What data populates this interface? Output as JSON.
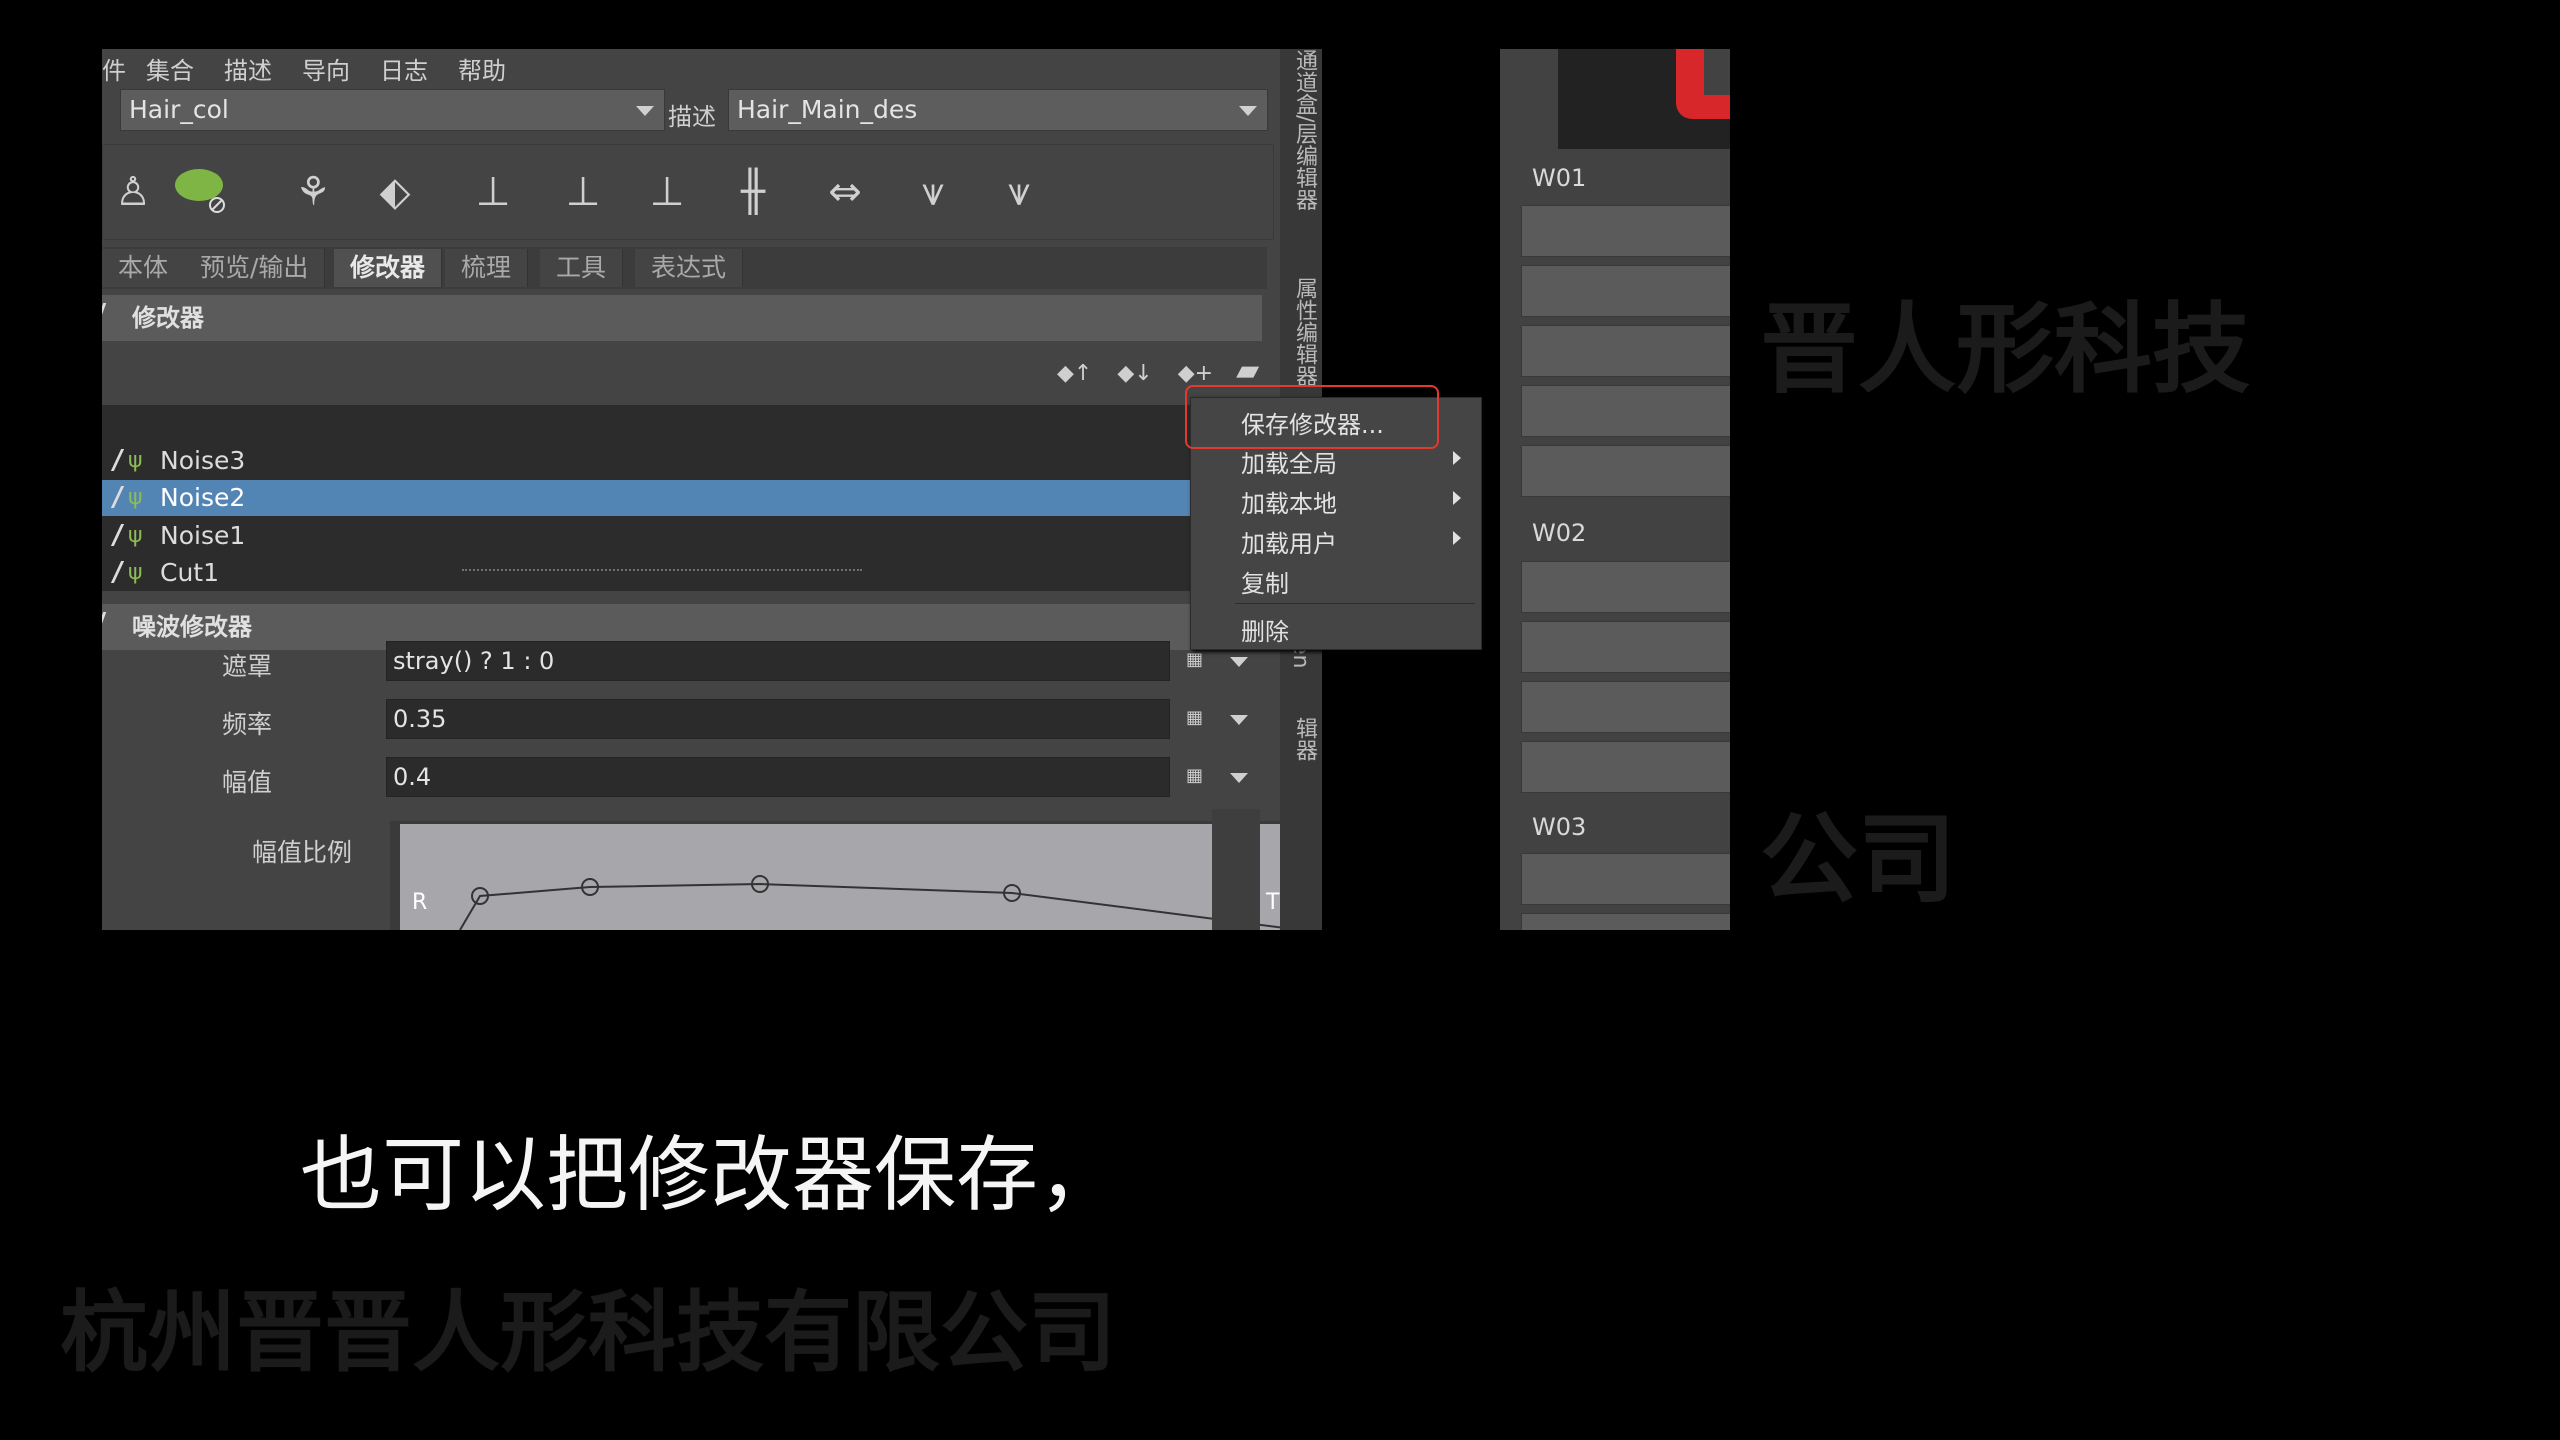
{
  "menubar": {
    "items": [
      "件",
      "集合",
      "描述",
      "导向",
      "日志",
      "帮助"
    ]
  },
  "collection": {
    "value": "Hair_col"
  },
  "description": {
    "label": "描述",
    "value": "Hair_Main_des"
  },
  "tabs": [
    {
      "label": "本体"
    },
    {
      "label": "预览/输出"
    },
    {
      "label": "修改器"
    },
    {
      "label": "梳理"
    },
    {
      "label": "工具"
    },
    {
      "label": "表达式"
    }
  ],
  "modifiers_section": {
    "title": "修改器"
  },
  "modifier_list": [
    "Noise3",
    "Noise2",
    "Noise1",
    "Cut1"
  ],
  "noise_section": {
    "title": "噪波修改器"
  },
  "fields": {
    "mask": {
      "label": "遮罩",
      "value": "stray() ? 1 : 0"
    },
    "frequency": {
      "label": "频率",
      "value": "0.35"
    },
    "magnitude": {
      "label": "幅值",
      "value": "0.4"
    },
    "magnitude_scale": {
      "label": "幅值比例"
    }
  },
  "ramp": {
    "left_label": "R",
    "right_label": "T"
  },
  "context_menu": {
    "items": [
      "保存修改器...",
      "加载全局",
      "加载本地",
      "加载用户",
      "复制",
      "删除"
    ]
  },
  "side_tabs": [
    "通道盒/层编辑器",
    "属性编辑器",
    "XGen 交互式梳理编辑器"
  ],
  "side_tab_partial": "en",
  "right_panel": {
    "labels": [
      "W01",
      "W02",
      "W03"
    ]
  },
  "subtitle": "也可以把修改器保存，",
  "watermark": {
    "line1": "晋人形科技",
    "line2": "公司",
    "line3": "杭州晋晋人形科技有限公司"
  },
  "colors": {
    "selection": "#5385b4",
    "highlight": "#e23a2e",
    "accent_red": "#d8272a"
  }
}
